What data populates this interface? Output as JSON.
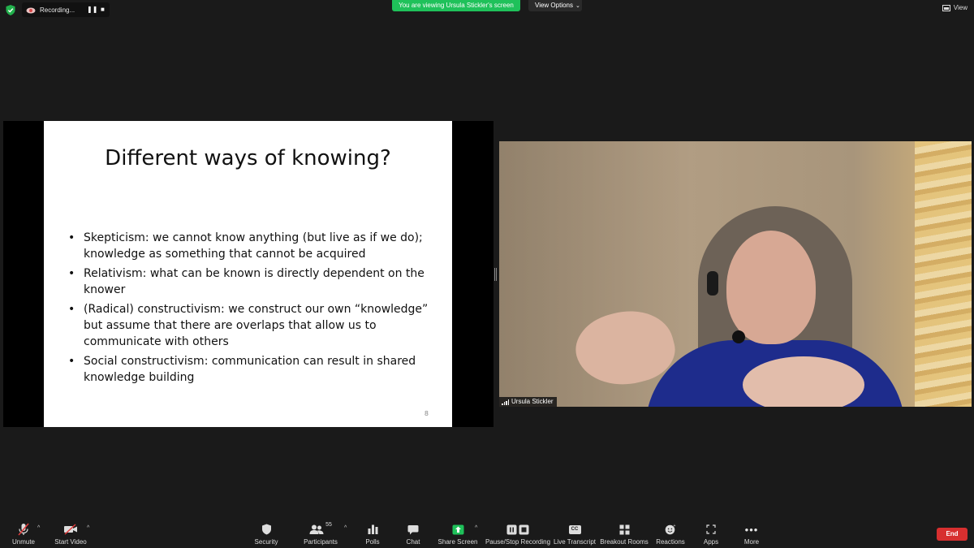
{
  "topbar": {
    "recording_label": "Recording...",
    "viewing_banner": "You are viewing Ursula Stickler's screen",
    "view_options_label": "View Options",
    "view_label": "View"
  },
  "slide": {
    "title": "Different ways of knowing?",
    "bullets": [
      "Skepticism: we cannot know anything (but live as if we do); knowledge as something that cannot be acquired",
      "Relativism: what can be known is directly dependent on the knower",
      "(Radical) constructivism: we construct our own “knowledge” but assume that there are overlaps that allow us to communicate with others",
      "Social constructivism: communication can result in shared knowledge building"
    ],
    "page_number": "8"
  },
  "video": {
    "participant_name": "Ursula Stickler"
  },
  "toolbar": {
    "unmute": "Unmute",
    "start_video": "Start Video",
    "security": "Security",
    "participants": "Participants",
    "participants_count": "55",
    "polls": "Polls",
    "chat": "Chat",
    "share_screen": "Share Screen",
    "pause_stop_recording": "Pause/Stop Recording",
    "live_transcript": "Live Transcript",
    "cc_badge": "CC",
    "breakout_rooms": "Breakout Rooms",
    "reactions": "Reactions",
    "apps": "Apps",
    "more": "More",
    "end": "End"
  },
  "colors": {
    "banner_green": "#1fc15a",
    "end_red": "#d72f2f",
    "share_green": "#1fc15a"
  }
}
